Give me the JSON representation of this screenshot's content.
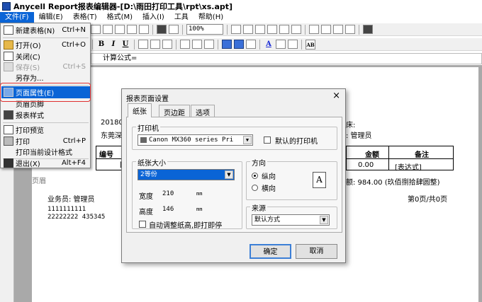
{
  "window": {
    "title": "Anycell Report报表编辑器-[D:\\雨田打印工具\\rpt\\xs.apt]"
  },
  "menubar": [
    "文件(F)",
    "编辑(E)",
    "表格(T)",
    "格式(M)",
    "插入(I)",
    "工具",
    "帮助(H)"
  ],
  "toolbar": {
    "zoom": "100%"
  },
  "format_toolbar": {
    "bold": "B",
    "italic": "I",
    "underline": "U",
    "font_color": "A",
    "ab": "AB"
  },
  "formula_bar": {
    "text": "计算公式="
  },
  "file_menu": {
    "items": [
      {
        "label": "新建表格(N)",
        "shortcut": "Ctrl+N",
        "icon": "new-document-icon"
      },
      {
        "label": "打开(O)",
        "shortcut": "Ctrl+O",
        "icon": "open-folder-icon"
      },
      {
        "label": "关闭(C)",
        "shortcut": "",
        "icon": "close-document-icon"
      },
      {
        "label": "保存(S)",
        "shortcut": "Ctrl+S",
        "icon": "save-icon"
      },
      {
        "label": "另存为...",
        "shortcut": "",
        "icon": ""
      },
      {
        "label": "页面属性(E)",
        "shortcut": "",
        "icon": "page-properties-icon"
      },
      {
        "label": "页眉页脚",
        "shortcut": "",
        "icon": ""
      },
      {
        "label": "报表样式",
        "shortcut": "",
        "icon": "report-style-icon"
      },
      {
        "label": "打印预览",
        "shortcut": "",
        "icon": "print-preview-icon"
      },
      {
        "label": "打印",
        "shortcut": "Ctrl+P",
        "icon": "print-icon"
      },
      {
        "label": "打印当前设计格式",
        "shortcut": "",
        "icon": ""
      },
      {
        "label": "退出(X)",
        "shortcut": "Alt+F4",
        "icon": "exit-icon"
      }
    ]
  },
  "sheet": {
    "date_fragment": "201801311",
    "company_fragment": "东莞深圳福田",
    "right_label_1": "床:",
    "right_label_2": ": 管理员",
    "col_code": "编号",
    "col_amount": "金额",
    "col_remark": "备注",
    "bracket": "[",
    "amount_value": "0.00",
    "remark_value": "[表达式]",
    "total_text": "额: 984.00 (玖佰捌拾肆圆整)",
    "header_fragment": "页眉",
    "salesman": "业务员: 管理员",
    "page_info": "第0页/共0页",
    "line1": "1111111111",
    "line2": "22222222 435345"
  },
  "dialog": {
    "title": "报表页面设置",
    "close": "×",
    "tabs": [
      "纸张",
      "页边距",
      "选项"
    ],
    "printer_group": "打印机",
    "printer_value": "Canon MX360 series Pri",
    "default_printer_label": "默认的打印机",
    "paper_group": "纸张大小",
    "paper_value": "2等份",
    "width_label": "宽度",
    "width_value": "210",
    "height_label": "高度",
    "height_value": "146",
    "unit": "mm",
    "auto_adjust_label": "自动调整纸高,即打即停",
    "orientation_group": "方向",
    "portrait_label": "纵向",
    "landscape_label": "横向",
    "orientation_icon_letter": "A",
    "source_group": "来源",
    "source_value": "默认方式",
    "ok": "确定",
    "cancel": "取消"
  },
  "colors": {
    "highlight": "#0a64d6",
    "callout": "#e03030",
    "workspace": "#a9a9a9"
  }
}
